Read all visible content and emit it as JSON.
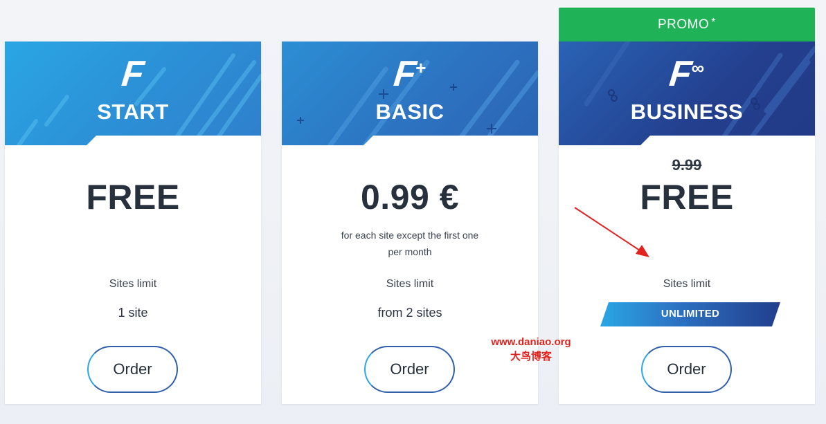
{
  "colors": {
    "promo_green": "#1fb257",
    "start_blue": "#2aa6e4",
    "basic_blue": "#2c74c2",
    "business_navy": "#233f8e",
    "text_dark": "#27303d",
    "arrow_red": "#e0231e"
  },
  "promo": {
    "label": "PROMO",
    "asterisk": "*"
  },
  "plans": [
    {
      "logo": "F",
      "logo_sup": "",
      "name": "START",
      "price": "FREE",
      "limit_label": "Sites limit",
      "limit_value": "1 site",
      "order_label": "Order"
    },
    {
      "logo": "F",
      "logo_sup": "+",
      "name": "BASIC",
      "price": "0.99 €",
      "note_line1": "for each site except the first one",
      "note_line2": "per month",
      "limit_label": "Sites limit",
      "limit_value": "from 2 sites",
      "order_label": "Order"
    },
    {
      "logo": "F",
      "logo_sup": "∞",
      "name": "BUSINESS",
      "old_price": "9.99",
      "price": "FREE",
      "limit_label": "Sites limit",
      "limit_value": "UNLIMITED",
      "order_label": "Order"
    }
  ],
  "watermark": {
    "url": "www.daniao.org",
    "name": "大鸟博客"
  },
  "icons": {
    "arrow": "red-arrow-icon"
  }
}
